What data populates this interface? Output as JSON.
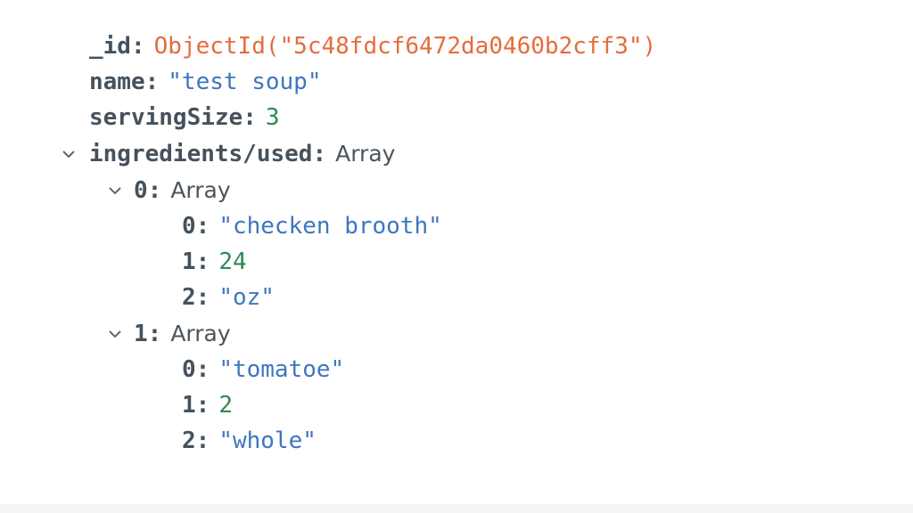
{
  "document": {
    "fields": [
      {
        "key": "_id",
        "value_prefix": "ObjectId(\"",
        "value_id": "5c48fdcf6472da0460b2cff3",
        "value_suffix": "\")",
        "type": "objectid"
      },
      {
        "key": "name",
        "value": "\"test soup\"",
        "type": "string"
      },
      {
        "key": "servingSize",
        "value": "3",
        "type": "number"
      },
      {
        "key": "ingredients/used",
        "value": "Array",
        "type": "array",
        "expanded": true,
        "items": [
          {
            "key": "0",
            "value": "Array",
            "expanded": true,
            "items": [
              {
                "key": "0",
                "value": "\"checken brooth\"",
                "type": "string"
              },
              {
                "key": "1",
                "value": "24",
                "type": "number"
              },
              {
                "key": "2",
                "value": "\"oz\"",
                "type": "string"
              }
            ]
          },
          {
            "key": "1",
            "value": "Array",
            "expanded": true,
            "items": [
              {
                "key": "0",
                "value": "\"tomatoe\"",
                "type": "string"
              },
              {
                "key": "1",
                "value": "2",
                "type": "number"
              },
              {
                "key": "2",
                "value": "\"whole\"",
                "type": "string"
              }
            ]
          }
        ]
      }
    ]
  },
  "colors": {
    "key": "#45525d",
    "objectid": "#e56c3d",
    "string": "#3f76bf",
    "number": "#2e8a52",
    "type_label": "#4a545c"
  },
  "icons": {
    "expand": "chevron-down-icon"
  }
}
